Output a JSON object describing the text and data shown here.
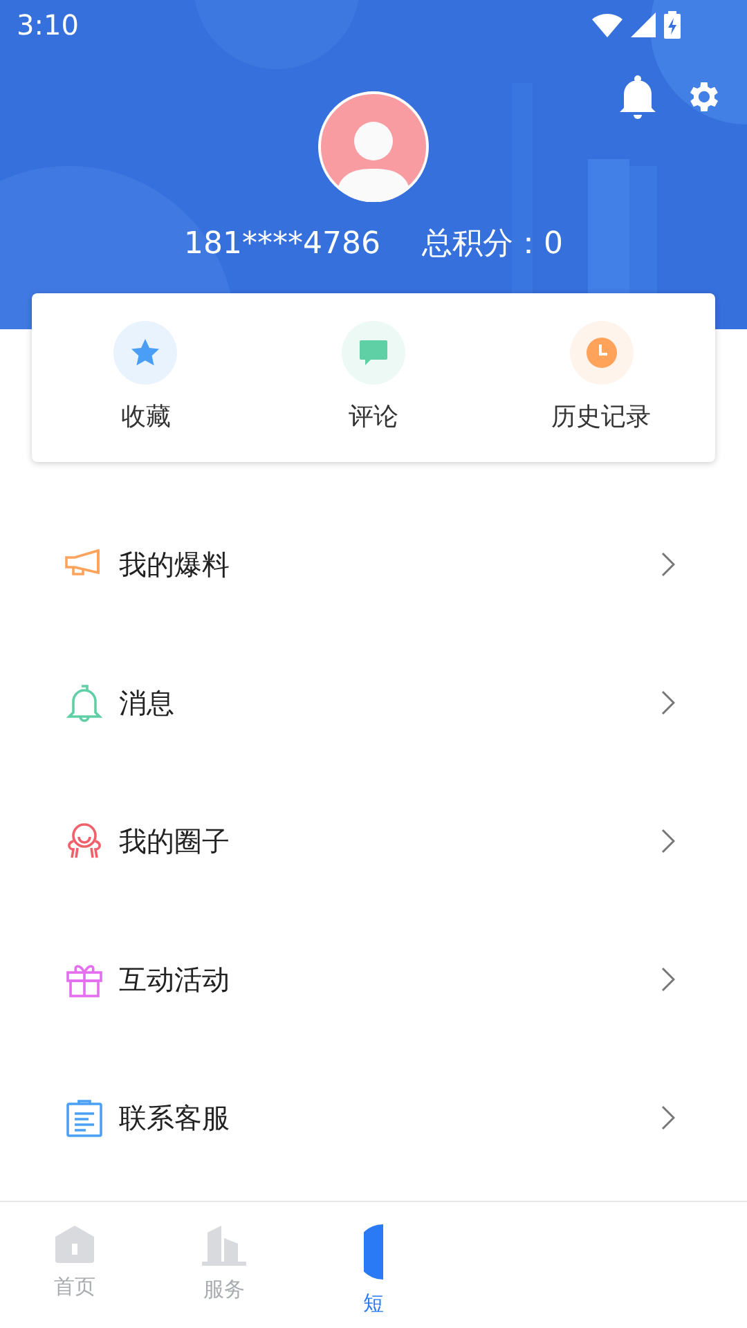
{
  "status_bar": {
    "time": "3:10"
  },
  "profile": {
    "phone": "181****4786",
    "points": "总积分：0"
  },
  "quick_actions": [
    {
      "label": "收藏",
      "kind": "star",
      "color": "#4a9ef5"
    },
    {
      "label": "评论",
      "kind": "comment",
      "color": "#5fcfa5"
    },
    {
      "label": "历史记录",
      "kind": "clock",
      "color": "#ffa25a"
    }
  ],
  "menu": [
    {
      "label": "我的爆料",
      "kind": "megaphone",
      "color": "#ffa25a"
    },
    {
      "label": "消息",
      "kind": "bell",
      "color": "#5fcfa5"
    },
    {
      "label": "我的圈子",
      "kind": "circle",
      "color": "#f0606a"
    },
    {
      "label": "互动活动",
      "kind": "gift",
      "color": "#e56ef0"
    },
    {
      "label": "联系客服",
      "kind": "clipboard",
      "color": "#4aa0f5"
    }
  ],
  "bottom_nav": [
    {
      "label": "首页",
      "kind": "home",
      "selected": false
    },
    {
      "label": "服务",
      "kind": "buildings",
      "selected": false
    },
    {
      "label": "短",
      "kind": "round",
      "selected": true
    }
  ]
}
